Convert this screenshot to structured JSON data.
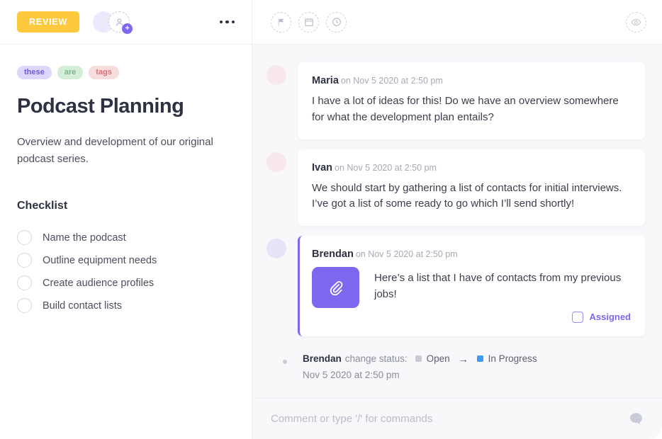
{
  "header": {
    "review_label": "REVIEW",
    "add_person_plus": "+",
    "tools": [
      {
        "name": "flag-icon"
      },
      {
        "name": "calendar-icon"
      },
      {
        "name": "clock-icon"
      }
    ],
    "watch_icon": "eye-icon"
  },
  "sidebar": {
    "tags": [
      "these",
      "are",
      "tags"
    ],
    "title": "Podcast Planning",
    "description": "Overview and development of our original podcast series.",
    "checklist_title": "Checklist",
    "checklist": [
      {
        "label": "Name the podcast",
        "checked": false
      },
      {
        "label": "Outline equipment needs",
        "checked": false
      },
      {
        "label": "Create audience profiles",
        "checked": false
      },
      {
        "label": "Build contact lists",
        "checked": false
      }
    ]
  },
  "conversation": {
    "messages": [
      {
        "author": "Maria",
        "time": "on Nov 5 2020 at 2:50 pm",
        "text": "I have a lot of ideas for this! Do we have an overview somewhere for what the development plan entails?",
        "avatar_color": "#f8e7ee"
      },
      {
        "author": "Ivan",
        "time": "on Nov 5 2020 at 2:50 pm",
        "text": "We should start by gathering a list of contacts for initial interviews. I’ve got a list of some ready to go which I’ll send shortly!",
        "avatar_color": "#f8e7ee"
      },
      {
        "author": "Brendan",
        "time": "on Nov 5 2020 at 2:50 pm",
        "text": "Here’s a list that I have of contacts from my previous jobs!",
        "avatar_color": "#e7e4fa",
        "attachment_icon": "paperclip-icon",
        "assigned_label": "Assigned",
        "assigned_checked": false
      }
    ],
    "activity": {
      "author": "Brendan",
      "verb": "change status:",
      "from_status": "Open",
      "from_color": "#c7cad6",
      "arrow": "→",
      "to_status": "In Progress",
      "to_color": "#3d9aef",
      "timestamp": "Nov 5 2020 at 2:50 pm"
    }
  },
  "composer": {
    "placeholder": "Comment or type '/' for commands",
    "value": "",
    "chat_icon": "chat-bubble-icon"
  },
  "colors": {
    "accent": "#7b68ee",
    "review": "#ffc93e",
    "tag_these_bg": "#ded7fb",
    "tag_are_bg": "#d4edd9",
    "tag_tags_bg": "#f6dcdc"
  }
}
